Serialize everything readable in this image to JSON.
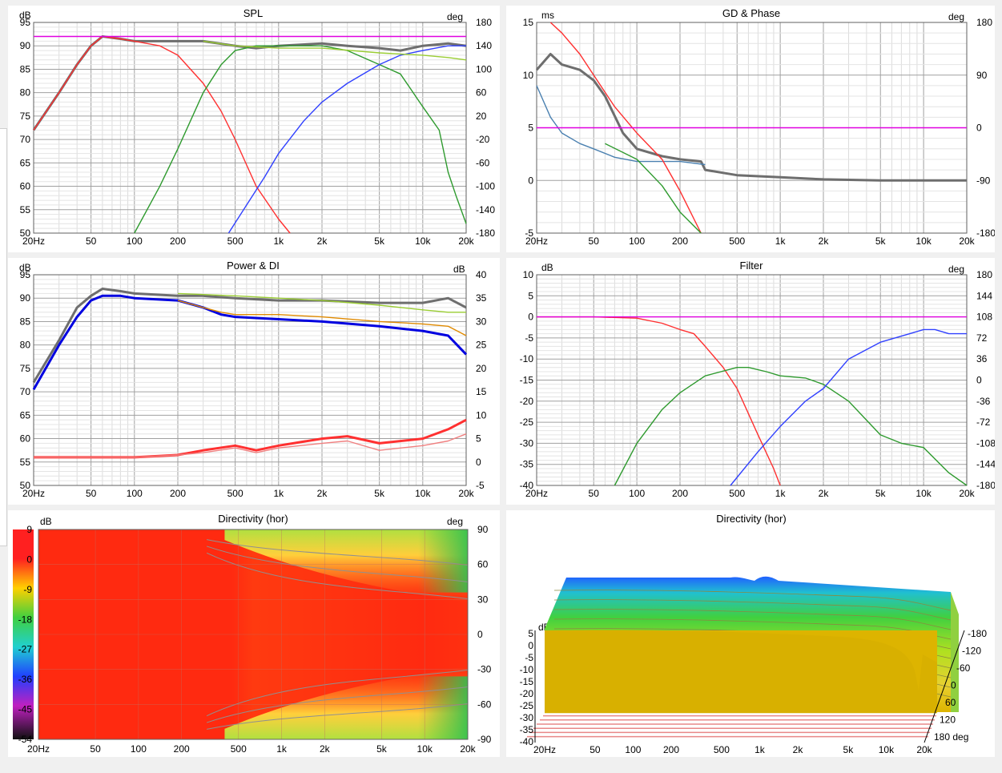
{
  "panels": {
    "spl": {
      "title": "SPL",
      "left_unit": "dB",
      "right_unit": "deg",
      "left_ticks": [
        "95",
        "90",
        "85",
        "80",
        "75",
        "70",
        "65",
        "60",
        "55",
        "50"
      ],
      "right_ticks": [
        "180",
        "140",
        "100",
        "60",
        "20",
        "-20",
        "-60",
        "-100",
        "-140",
        "-180"
      ]
    },
    "gd": {
      "title": "GD & Phase",
      "left_unit": "ms",
      "right_unit": "deg",
      "left_ticks": [
        "15",
        "10",
        "5",
        "0",
        "-5"
      ],
      "right_ticks": [
        "180",
        "90",
        "0",
        "-90",
        "-180"
      ]
    },
    "power": {
      "title": "Power & DI",
      "left_unit": "dB",
      "right_unit": "dB",
      "left_ticks": [
        "95",
        "90",
        "85",
        "80",
        "75",
        "70",
        "65",
        "60",
        "55",
        "50"
      ],
      "right_ticks": [
        "40",
        "35",
        "30",
        "25",
        "20",
        "15",
        "10",
        "5",
        "0",
        "-5"
      ]
    },
    "filter": {
      "title": "Filter",
      "left_unit": "dB",
      "right_unit": "deg",
      "left_ticks": [
        "10",
        "5",
        "0",
        "-5",
        "-10",
        "-15",
        "-20",
        "-25",
        "-30",
        "-35",
        "-40"
      ],
      "right_ticks": [
        "180",
        "144",
        "108",
        "72",
        "36",
        "0",
        "-36",
        "-72",
        "-108",
        "-144",
        "-180"
      ]
    },
    "dir_map": {
      "title": "Directivity (hor)",
      "left_unit": "dB",
      "right_unit": "deg",
      "scale_ticks": [
        "9",
        "0",
        "-9",
        "-18",
        "-27",
        "-36",
        "-45",
        "-54"
      ],
      "right_ticks": [
        "90",
        "60",
        "30",
        "0",
        "-30",
        "-60",
        "-90"
      ]
    },
    "dir_3d": {
      "title": "Directivity (hor)",
      "left_unit": "dB",
      "left_ticks": [
        "5",
        "0",
        "-5",
        "-10",
        "-15",
        "-20",
        "-25",
        "-30",
        "-35",
        "-40"
      ],
      "depth_ticks": [
        "-180",
        "-120",
        "-60",
        "0",
        "60",
        "120",
        "180 deg"
      ]
    }
  },
  "x_ticks": [
    "20Hz",
    "50",
    "100",
    "200",
    "500",
    "1k",
    "2k",
    "5k",
    "10k",
    "20k"
  ],
  "colors": {
    "magenta": "#e000e0",
    "red": "#ff3030",
    "green": "#2e9a2e",
    "blue": "#3040ff",
    "gray": "#6e6e6e",
    "lightgreen": "#9acd32",
    "orange": "#e08a00",
    "cyan": "#30c0e0",
    "darkblue": "#0000e0",
    "pink": "#f08080",
    "steelblue": "#4a80b0"
  },
  "chart_data": [
    {
      "type": "line",
      "title": "SPL",
      "xscale": "log",
      "xlim": [
        20,
        20000
      ],
      "ylim": [
        50,
        95
      ],
      "y2lim": [
        -180,
        180
      ],
      "series": [
        {
          "color": "gray",
          "x": [
            20,
            30,
            40,
            50,
            60,
            80,
            100,
            150,
            200,
            300,
            500,
            700,
            1000,
            2000,
            3000,
            5000,
            7000,
            10000,
            15000,
            20000
          ],
          "y": [
            72,
            80,
            86,
            90,
            92,
            91.5,
            91,
            91,
            91,
            91,
            90,
            89.5,
            90,
            90.5,
            90,
            89.5,
            89,
            90,
            90.5,
            90
          ]
        },
        {
          "color": "red",
          "x": [
            20,
            30,
            40,
            50,
            60,
            80,
            100,
            150,
            200,
            300,
            400,
            500,
            700,
            1000,
            1200
          ],
          "y": [
            72,
            80,
            86,
            90,
            92,
            91.5,
            91,
            90,
            88,
            82,
            76,
            70,
            60,
            53,
            50
          ]
        },
        {
          "color": "green",
          "x": [
            100,
            150,
            200,
            300,
            400,
            500,
            700,
            1000,
            2000,
            3000,
            5000,
            7000,
            10000,
            13000,
            15000,
            17000,
            20000
          ],
          "y": [
            50,
            60,
            68,
            80,
            86,
            89,
            90,
            90,
            90,
            89,
            86,
            84,
            77,
            72,
            63,
            58,
            52
          ]
        },
        {
          "color": "blue",
          "x": [
            450,
            600,
            800,
            1000,
            1500,
            2000,
            3000,
            5000,
            7000,
            10000,
            15000,
            20000
          ],
          "y": [
            50,
            56,
            62,
            67,
            74,
            78,
            82,
            86,
            88,
            89,
            90,
            90
          ]
        },
        {
          "color": "lightgreen",
          "x": [
            300,
            500,
            1000,
            2000,
            5000,
            10000,
            15000,
            20000
          ],
          "y": [
            91,
            90,
            89.5,
            89.5,
            88.5,
            88,
            87.5,
            87
          ]
        },
        {
          "color": "magenta",
          "x": [
            20,
            20000
          ],
          "y": [
            92,
            92
          ]
        }
      ]
    },
    {
      "type": "line",
      "title": "GD & Phase",
      "xscale": "log",
      "xlim": [
        20,
        20000
      ],
      "ylim": [
        -5,
        15
      ],
      "y2lim": [
        -180,
        180
      ],
      "series": [
        {
          "color": "gray",
          "x": [
            20,
            25,
            30,
            40,
            50,
            60,
            80,
            100,
            150,
            200,
            280,
            300,
            500,
            1000,
            2000,
            5000,
            10000,
            20000
          ],
          "y": [
            10.5,
            12,
            11,
            10.5,
            9.5,
            8,
            4.5,
            3,
            2.3,
            2,
            1.8,
            1,
            0.5,
            0.3,
            0.1,
            0,
            0,
            0
          ]
        },
        {
          "color": "steelblue",
          "x": [
            20,
            25,
            30,
            40,
            50,
            70,
            100,
            150,
            200,
            300
          ],
          "y": [
            9,
            6,
            4.5,
            3.5,
            3,
            2.2,
            1.8,
            1.8,
            1.8,
            1.5
          ]
        },
        {
          "color": "red",
          "x": [
            25,
            30,
            40,
            50,
            70,
            100,
            150,
            200,
            280
          ],
          "y": [
            15,
            14,
            12,
            10,
            7,
            4.5,
            2,
            -1,
            -5
          ]
        },
        {
          "color": "green",
          "x": [
            60,
            100,
            150,
            200,
            280
          ],
          "y": [
            3.5,
            2,
            -0.5,
            -3,
            -5
          ]
        },
        {
          "color": "magenta",
          "x": [
            20,
            20000
          ],
          "y": [
            5,
            5
          ]
        }
      ]
    },
    {
      "type": "line",
      "title": "Power & DI",
      "xscale": "log",
      "xlim": [
        20,
        20000
      ],
      "ylim": [
        50,
        95
      ],
      "y2lim": [
        -5,
        40
      ],
      "series": [
        {
          "color": "gray",
          "x": [
            20,
            30,
            40,
            50,
            60,
            80,
            100,
            200,
            300,
            500,
            1000,
            2000,
            5000,
            10000,
            15000,
            20000
          ],
          "y": [
            72,
            81,
            88,
            90.5,
            92,
            91.5,
            91,
            90.5,
            90.5,
            90,
            89.5,
            89.5,
            89,
            89,
            90,
            88
          ]
        },
        {
          "color": "darkblue",
          "x": [
            20,
            30,
            40,
            50,
            60,
            80,
            100,
            200,
            300,
            400,
            500,
            1000,
            2000,
            5000,
            10000,
            15000,
            20000
          ],
          "y": [
            70.5,
            80,
            86,
            89.5,
            90.5,
            90.5,
            90,
            89.5,
            88,
            86.5,
            86,
            85.5,
            85,
            84,
            83,
            82,
            78
          ]
        },
        {
          "color": "orange",
          "x": [
            200,
            300,
            400,
            500,
            1000,
            2000,
            5000,
            10000,
            15000,
            20000
          ],
          "y": [
            89.5,
            88,
            87,
            86.5,
            86.5,
            86,
            85,
            84.5,
            84,
            82
          ]
        },
        {
          "color": "red",
          "x": [
            20,
            100,
            200,
            300,
            500,
            700,
            1000,
            2000,
            3000,
            5000,
            10000,
            15000,
            20000
          ],
          "y": [
            56,
            56,
            56.5,
            57.5,
            58.5,
            57.5,
            58.5,
            60,
            60.5,
            59,
            60,
            62,
            64
          ]
        },
        {
          "color": "pink",
          "x": [
            20,
            100,
            200,
            300,
            500,
            700,
            1000,
            2000,
            3000,
            5000,
            10000,
            15000,
            20000
          ],
          "y": [
            56,
            56,
            56.5,
            57,
            58,
            57,
            58,
            59,
            59.5,
            57.5,
            58.5,
            59.5,
            61
          ]
        },
        {
          "color": "lightgreen",
          "x": [
            200,
            500,
            1000,
            2000,
            5000,
            10000,
            15000,
            20000
          ],
          "y": [
            91,
            90.5,
            90,
            89.5,
            88.5,
            87.5,
            87,
            87
          ]
        }
      ]
    },
    {
      "type": "line",
      "title": "Filter",
      "xscale": "log",
      "xlim": [
        20,
        20000
      ],
      "ylim": [
        -40,
        10
      ],
      "y2lim": [
        -180,
        180
      ],
      "series": [
        {
          "color": "red",
          "x": [
            20,
            50,
            100,
            150,
            200,
            250,
            300,
            400,
            500,
            700,
            900,
            1000
          ],
          "y": [
            0,
            0,
            -0.3,
            -1.5,
            -3,
            -4,
            -7,
            -12,
            -17,
            -28,
            -36,
            -40
          ]
        },
        {
          "color": "green",
          "x": [
            70,
            100,
            150,
            200,
            300,
            500,
            600,
            800,
            1000,
            1500,
            2000,
            3000,
            5000,
            7000,
            10000,
            15000,
            20000
          ],
          "y": [
            -40,
            -30,
            -22,
            -18,
            -14,
            -12,
            -12,
            -13,
            -14,
            -14.5,
            -16,
            -20,
            -28,
            -30,
            -31,
            -37,
            -40
          ]
        },
        {
          "color": "blue",
          "x": [
            450,
            700,
            1000,
            1500,
            2000,
            3000,
            5000,
            8000,
            10000,
            12000,
            15000,
            20000
          ],
          "y": [
            -40,
            -32,
            -26,
            -20,
            -17,
            -10,
            -6,
            -4,
            -3,
            -3,
            -4,
            -4
          ]
        },
        {
          "color": "magenta",
          "x": [
            20,
            20000
          ],
          "y": [
            0,
            0
          ]
        }
      ]
    },
    {
      "type": "heatmap",
      "title": "Directivity (hor)",
      "xscale": "log",
      "xlim": [
        20,
        20000
      ],
      "ylim": [
        -90,
        90
      ],
      "zlim": [
        -54,
        9
      ]
    },
    {
      "type": "area",
      "title": "Directivity (hor)",
      "xscale": "log",
      "xlim": [
        20,
        20000
      ],
      "ylim": [
        -40,
        5
      ],
      "zlim": [
        -180,
        180
      ]
    }
  ]
}
